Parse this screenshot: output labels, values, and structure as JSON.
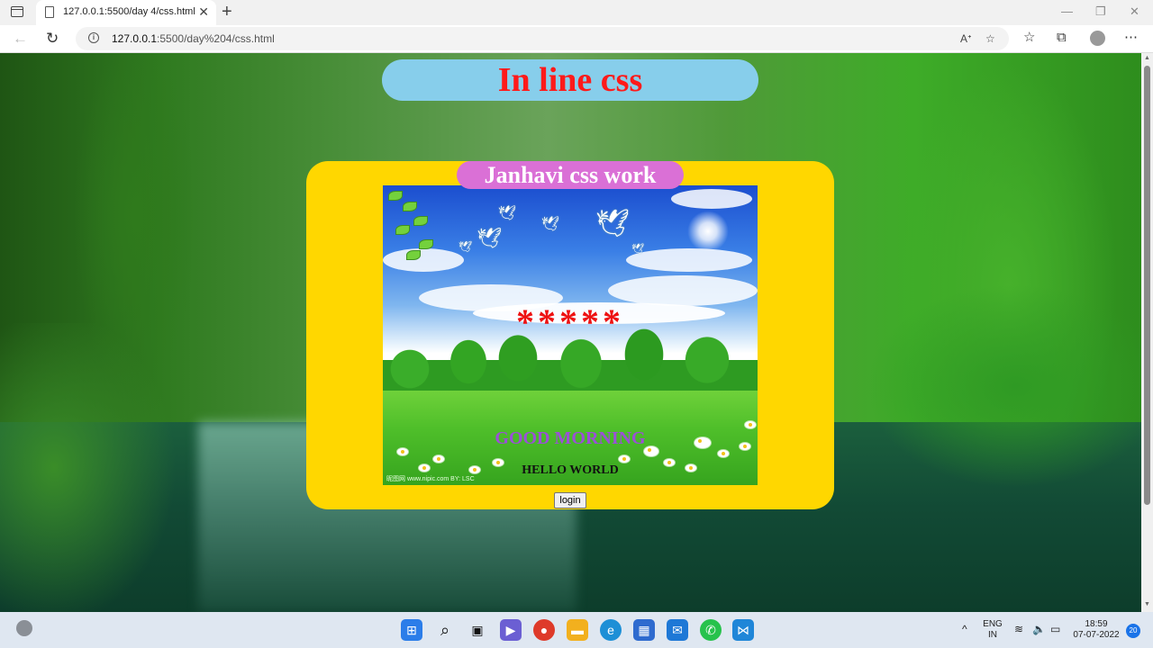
{
  "browser": {
    "tab_title": "127.0.0.1:5500/day 4/css.html",
    "tab_close": "✕",
    "new_tab": "+",
    "url_host": "127.0.0.1",
    "url_rest": ":5500/day%204/css.html",
    "window_controls": [
      "—",
      "❐",
      "✕"
    ]
  },
  "page": {
    "heading": "In line css",
    "card_title": "Janhavi css work",
    "stars": "*****",
    "greeting": "GOOD MORNING",
    "hello": "HELLO WORLD",
    "image_credit": "昵图网 www.nipic.com  BY: LSC",
    "login_label": "login"
  },
  "taskbar": {
    "language": "ENG",
    "region": "IN",
    "time": "18:59",
    "date": "07-07-2022",
    "notification_count": "20"
  }
}
